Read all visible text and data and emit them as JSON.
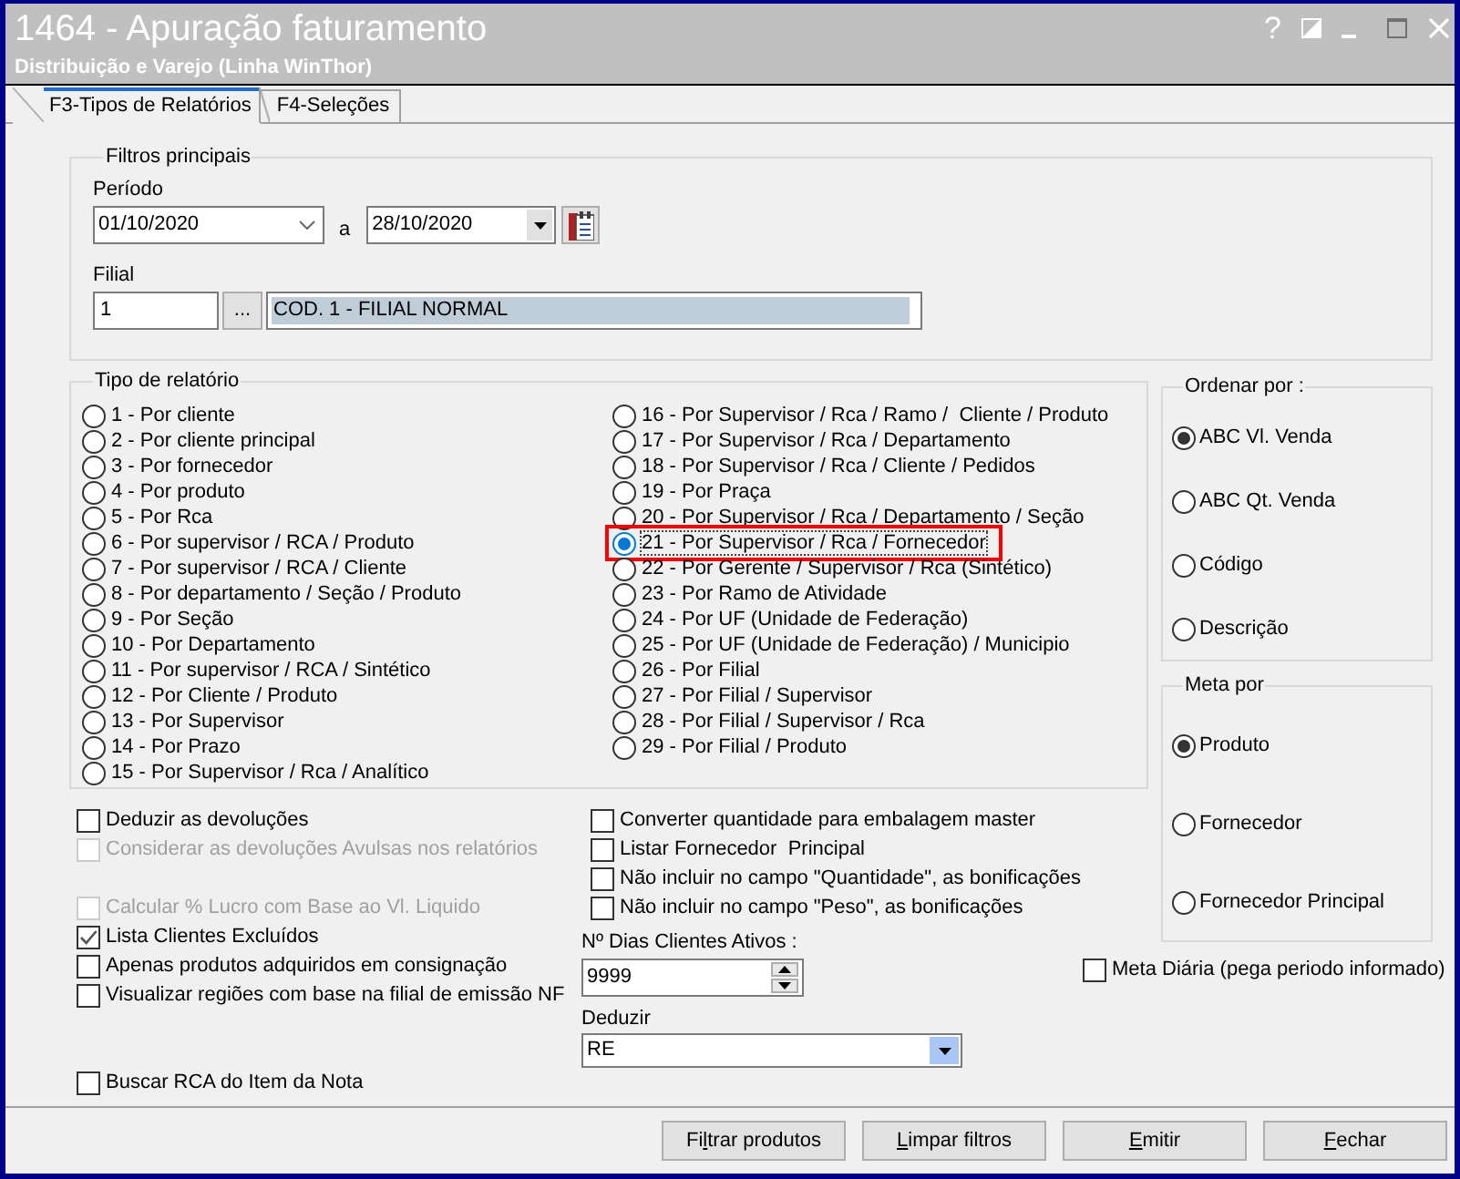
{
  "window": {
    "title": "1464 - Apuração faturamento",
    "subtitle": "Distribuição e Varejo (Linha WinThor)",
    "help": "?"
  },
  "tabs": [
    {
      "label": "F3-Tipos de Relatórios",
      "selected": true
    },
    {
      "label": "F4-Seleções",
      "selected": false
    }
  ],
  "main_filters": {
    "title": "Filtros principais",
    "period": {
      "label": "Período",
      "from": "01/10/2020",
      "separator": "a",
      "to": "28/10/2020"
    },
    "branch": {
      "label": "Filial",
      "code": "1",
      "lookup_button": "...",
      "description": "COD. 1 - FILIAL NORMAL"
    }
  },
  "report_type": {
    "title": "Tipo de relatório",
    "options": [
      {
        "label": "1 - Por cliente",
        "selected": false,
        "highlighted": false
      },
      {
        "label": "2 - Por cliente principal",
        "selected": false,
        "highlighted": false
      },
      {
        "label": "3 - Por fornecedor",
        "selected": false,
        "highlighted": false
      },
      {
        "label": "4 - Por produto",
        "selected": false,
        "highlighted": false
      },
      {
        "label": "5 - Por Rca",
        "selected": false,
        "highlighted": false
      },
      {
        "label": "6 - Por supervisor / RCA / Produto",
        "selected": false,
        "highlighted": false
      },
      {
        "label": "7 - Por supervisor / RCA / Cliente",
        "selected": false,
        "highlighted": false
      },
      {
        "label": "8 - Por departamento / Seção / Produto",
        "selected": false,
        "highlighted": false
      },
      {
        "label": "9 - Por Seção",
        "selected": false,
        "highlighted": false
      },
      {
        "label": "10 - Por Departamento",
        "selected": false,
        "highlighted": false
      },
      {
        "label": "11 - Por supervisor / RCA / Sintético",
        "selected": false,
        "highlighted": false
      },
      {
        "label": "12 - Por Cliente / Produto",
        "selected": false,
        "highlighted": false
      },
      {
        "label": "13 - Por Supervisor",
        "selected": false,
        "highlighted": false
      },
      {
        "label": "14 - Por Prazo",
        "selected": false,
        "highlighted": false
      },
      {
        "label": "15 - Por Supervisor / Rca / Analítico",
        "selected": false,
        "highlighted": false
      },
      {
        "label": "16 - Por Supervisor / Rca / Ramo /  Cliente / Produto",
        "selected": false,
        "highlighted": false
      },
      {
        "label": "17 - Por Supervisor / Rca / Departamento",
        "selected": false,
        "highlighted": false
      },
      {
        "label": "18 - Por Supervisor / Rca / Cliente / Pedidos",
        "selected": false,
        "highlighted": false
      },
      {
        "label": "19 - Por Praça",
        "selected": false,
        "highlighted": false
      },
      {
        "label": "20 - Por Supervisor / Rca / Departamento / Seção",
        "selected": false,
        "highlighted": false
      },
      {
        "label": "21 - Por Supervisor / Rca / Fornecedor",
        "selected": true,
        "highlighted": true
      },
      {
        "label": "22 - Por Gerente / Supervisor / Rca (Sintético)",
        "selected": false,
        "highlighted": false
      },
      {
        "label": "23 - Por Ramo de Atividade",
        "selected": false,
        "highlighted": false
      },
      {
        "label": "24 - Por UF (Unidade de Federação)",
        "selected": false,
        "highlighted": false
      },
      {
        "label": "25 - Por UF (Unidade de Federação) / Municipio",
        "selected": false,
        "highlighted": false
      },
      {
        "label": "26 - Por Filial",
        "selected": false,
        "highlighted": false
      },
      {
        "label": "27 - Por Filial / Supervisor",
        "selected": false,
        "highlighted": false
      },
      {
        "label": "28 - Por Filial / Supervisor / Rca",
        "selected": false,
        "highlighted": false
      },
      {
        "label": "29 - Por Filial / Produto",
        "selected": false,
        "highlighted": false
      }
    ]
  },
  "sort_by": {
    "title": "Ordenar por :",
    "options": [
      {
        "label": "ABC Vl. Venda",
        "selected": true
      },
      {
        "label": "ABC Qt. Venda",
        "selected": false
      },
      {
        "label": "Código",
        "selected": false
      },
      {
        "label": "Descrição",
        "selected": false
      }
    ]
  },
  "target_by": {
    "title": "Meta por",
    "options": [
      {
        "label": "Produto",
        "selected": true
      },
      {
        "label": "Fornecedor",
        "selected": false
      },
      {
        "label": "Fornecedor Principal",
        "selected": false
      }
    ]
  },
  "checks_left": {
    "top": [
      {
        "label": "Deduzir as devoluções",
        "checked": false,
        "disabled": false
      },
      {
        "label": "Considerar as devoluções Avulsas nos relatórios",
        "checked": false,
        "disabled": true
      }
    ],
    "middle": [
      {
        "label": "Calcular % Lucro com Base ao Vl. Liquido",
        "checked": false,
        "disabled": true
      },
      {
        "label": "Lista Clientes Excluídos",
        "checked": true,
        "disabled": false
      },
      {
        "label": "Apenas produtos adquiridos em consignação",
        "checked": false,
        "disabled": false
      },
      {
        "label": "Visualizar regiões com base na filial de emissão NF",
        "checked": false,
        "disabled": false
      }
    ],
    "bottom": [
      {
        "label": "Buscar RCA do Item da Nota",
        "checked": false,
        "disabled": false
      }
    ]
  },
  "checks_middle": [
    {
      "label": "Converter quantidade para embalagem master",
      "checked": false
    },
    {
      "label": "Listar Fornecedor  Principal",
      "checked": false
    },
    {
      "label": "Não incluir no campo \"Quantidade\", as bonificações",
      "checked": false
    },
    {
      "label": "Não incluir no campo \"Peso\", as bonificações",
      "checked": false
    }
  ],
  "active_clients_days": {
    "label": "Nº Dias Clientes Ativos :",
    "value": "9999"
  },
  "deduct": {
    "label": "Deduzir",
    "value": "RE"
  },
  "daily_target": {
    "label": "Meta Diária (pega periodo informado)",
    "checked": false
  },
  "buttons": [
    {
      "before": "Fi",
      "key": "l",
      "after": "trar produtos"
    },
    {
      "key": "L",
      "after": "impar filtros"
    },
    {
      "key": "E",
      "after": "mitir"
    },
    {
      "key": "F",
      "after": "echar"
    }
  ]
}
